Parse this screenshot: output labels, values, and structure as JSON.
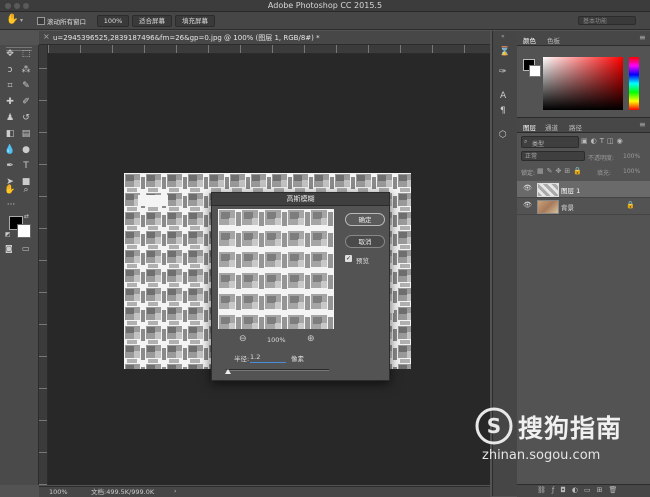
{
  "app": {
    "title": "Adobe Photoshop CC 2015.5"
  },
  "options_bar": {
    "scroll_all_label": "滚动所有窗口",
    "zoom_100": "100%",
    "fit_screen": "适合屏幕",
    "fill_screen": "填充屏幕",
    "workspace": "基本功能"
  },
  "document": {
    "tab_title": "u=2945396525,2839187496&fm=26&gp=0.jpg @ 100% (图层 1, RGB/8#) *",
    "zoom": "100%",
    "doc_size": "文档:499.5K/999.0K"
  },
  "dialog": {
    "title": "高斯模糊",
    "ok": "确定",
    "cancel": "取消",
    "preview_label": "预览",
    "preview_checked": true,
    "zoom_level": "100%",
    "radius_label": "半径:",
    "radius_value": "1.2",
    "radius_unit": "像素"
  },
  "color_panel": {
    "tab_color": "颜色",
    "tab_swatches": "色板"
  },
  "layers_panel": {
    "tab_layers": "图层",
    "tab_channels": "通道",
    "tab_paths": "路径",
    "filter_kind": "类型",
    "blend_mode": "正常",
    "opacity_label": "不透明度:",
    "opacity_value": "100%",
    "lock_label": "锁定:",
    "fill_label": "填充:",
    "fill_value": "100%",
    "layers": [
      {
        "name": "图层 1",
        "selected": true
      },
      {
        "name": "背景",
        "locked": true
      }
    ]
  },
  "watermark": {
    "brand": "搜狗指南",
    "url": "zhinan.sogou.com"
  }
}
